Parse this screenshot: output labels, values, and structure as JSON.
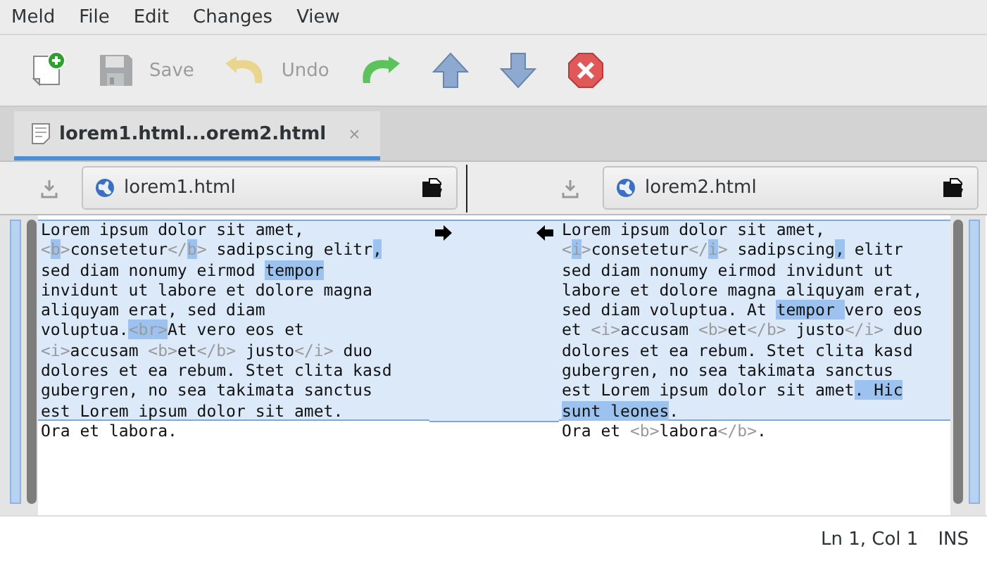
{
  "menu": [
    "Meld",
    "File",
    "Edit",
    "Changes",
    "View"
  ],
  "toolbar": [
    {
      "kind": "new",
      "disabled": false
    },
    {
      "kind": "save",
      "label": "Save",
      "disabled": true
    },
    {
      "kind": "undo",
      "label": "Undo",
      "disabled": true
    },
    {
      "kind": "redo",
      "disabled": false
    },
    {
      "kind": "up",
      "disabled": false
    },
    {
      "kind": "down",
      "disabled": false
    },
    {
      "kind": "stop",
      "disabled": false
    }
  ],
  "tabs": [
    {
      "label": "lorem1.html...orem2.html",
      "close": "×",
      "selected": true
    }
  ],
  "panes": [
    {
      "file": "lorem1.html",
      "lines": [
        {
          "changed": true,
          "segments": [
            {
              "text": "Lorem ipsum dolor sit amet,",
              "markup": false,
              "highlighted": false
            }
          ]
        },
        {
          "changed": true,
          "segments": [
            {
              "text": "<",
              "markup": true,
              "highlighted": false
            },
            {
              "text": "b",
              "markup": true,
              "highlighted": true
            },
            {
              "text": ">",
              "markup": true,
              "highlighted": false
            },
            {
              "text": "consetetur",
              "markup": false,
              "highlighted": false
            },
            {
              "text": "</",
              "markup": true,
              "highlighted": false
            },
            {
              "text": "b",
              "markup": true,
              "highlighted": true
            },
            {
              "text": ">",
              "markup": true,
              "highlighted": false
            },
            {
              "text": " sadipscing elitr",
              "markup": false,
              "highlighted": false
            },
            {
              "text": ",",
              "markup": false,
              "highlighted": true
            }
          ]
        },
        {
          "changed": true,
          "segments": [
            {
              "text": "sed diam nonumy eirmod ",
              "markup": false,
              "highlighted": false
            },
            {
              "text": "tempor",
              "markup": false,
              "highlighted": true
            }
          ]
        },
        {
          "changed": true,
          "segments": [
            {
              "text": "invidunt ut labore et dolore magna",
              "markup": false,
              "highlighted": false
            }
          ]
        },
        {
          "changed": true,
          "segments": [
            {
              "text": "aliquyam erat, sed diam",
              "markup": false,
              "highlighted": false
            }
          ]
        },
        {
          "changed": true,
          "segments": [
            {
              "text": "voluptua.",
              "markup": false,
              "highlighted": false
            },
            {
              "text": "<br>",
              "markup": true,
              "highlighted": true
            },
            {
              "text": "At vero eos et",
              "markup": false,
              "highlighted": false
            }
          ]
        },
        {
          "changed": true,
          "segments": [
            {
              "text": "<i>",
              "markup": true,
              "highlighted": false
            },
            {
              "text": "accusam ",
              "markup": false,
              "highlighted": false
            },
            {
              "text": "<b>",
              "markup": true,
              "highlighted": false
            },
            {
              "text": "et",
              "markup": false,
              "highlighted": false
            },
            {
              "text": "</b>",
              "markup": true,
              "highlighted": false
            },
            {
              "text": " justo",
              "markup": false,
              "highlighted": false
            },
            {
              "text": "</i>",
              "markup": true,
              "highlighted": false
            },
            {
              "text": " duo",
              "markup": false,
              "highlighted": false
            }
          ]
        },
        {
          "changed": true,
          "segments": [
            {
              "text": "dolores et ea rebum. Stet clita kasd",
              "markup": false,
              "highlighted": false
            }
          ]
        },
        {
          "changed": true,
          "segments": [
            {
              "text": "gubergren, no sea takimata sanctus",
              "markup": false,
              "highlighted": false
            }
          ]
        },
        {
          "changed": true,
          "segments": [
            {
              "text": "est Lorem ipsum dolor sit amet.",
              "markup": false,
              "highlighted": false
            }
          ]
        },
        {
          "changed": false,
          "segments": [
            {
              "text": "Ora et labora.",
              "markup": false,
              "highlighted": false
            }
          ]
        }
      ]
    },
    {
      "file": "lorem2.html",
      "lines": [
        {
          "changed": true,
          "segments": [
            {
              "text": "Lorem ipsum dolor sit amet,",
              "markup": false,
              "highlighted": false
            }
          ]
        },
        {
          "changed": true,
          "segments": [
            {
              "text": "<",
              "markup": true,
              "highlighted": false
            },
            {
              "text": "i",
              "markup": true,
              "highlighted": true
            },
            {
              "text": ">",
              "markup": true,
              "highlighted": false
            },
            {
              "text": "consetetur",
              "markup": false,
              "highlighted": false
            },
            {
              "text": "</",
              "markup": true,
              "highlighted": false
            },
            {
              "text": "i",
              "markup": true,
              "highlighted": true
            },
            {
              "text": ">",
              "markup": true,
              "highlighted": false
            },
            {
              "text": " sadipscing",
              "markup": false,
              "highlighted": false
            },
            {
              "text": ",",
              "markup": false,
              "highlighted": true
            },
            {
              "text": " elitr",
              "markup": false,
              "highlighted": false
            }
          ]
        },
        {
          "changed": true,
          "segments": [
            {
              "text": "sed diam nonumy eirmod invidunt ut",
              "markup": false,
              "highlighted": false
            }
          ]
        },
        {
          "changed": true,
          "segments": [
            {
              "text": "labore et dolore magna aliquyam erat,",
              "markup": false,
              "highlighted": false
            }
          ]
        },
        {
          "changed": true,
          "segments": [
            {
              "text": "sed diam voluptua. At ",
              "markup": false,
              "highlighted": false
            },
            {
              "text": "tempor ",
              "markup": false,
              "highlighted": true
            },
            {
              "text": "vero eos",
              "markup": false,
              "highlighted": false
            }
          ]
        },
        {
          "changed": true,
          "segments": [
            {
              "text": "et ",
              "markup": false,
              "highlighted": false
            },
            {
              "text": "<i>",
              "markup": true,
              "highlighted": false
            },
            {
              "text": "accusam ",
              "markup": false,
              "highlighted": false
            },
            {
              "text": "<b>",
              "markup": true,
              "highlighted": false
            },
            {
              "text": "et",
              "markup": false,
              "highlighted": false
            },
            {
              "text": "</b>",
              "markup": true,
              "highlighted": false
            },
            {
              "text": " justo",
              "markup": false,
              "highlighted": false
            },
            {
              "text": "</i>",
              "markup": true,
              "highlighted": false
            },
            {
              "text": " duo",
              "markup": false,
              "highlighted": false
            }
          ]
        },
        {
          "changed": true,
          "segments": [
            {
              "text": "dolores et ea rebum. Stet clita kasd",
              "markup": false,
              "highlighted": false
            }
          ]
        },
        {
          "changed": true,
          "segments": [
            {
              "text": "gubergren, no sea takimata sanctus",
              "markup": false,
              "highlighted": false
            }
          ]
        },
        {
          "changed": true,
          "segments": [
            {
              "text": "est Lorem ipsum dolor sit amet",
              "markup": false,
              "highlighted": false
            },
            {
              "text": ". Hic",
              "markup": false,
              "highlighted": true
            }
          ]
        },
        {
          "changed": true,
          "segments": [
            {
              "text": "sunt leones",
              "markup": false,
              "highlighted": true
            },
            {
              "text": ".",
              "markup": false,
              "highlighted": false
            }
          ]
        },
        {
          "changed": false,
          "segments": [
            {
              "text": "Ora et ",
              "markup": false,
              "highlighted": false
            },
            {
              "text": "<b>",
              "markup": true,
              "highlighted": false
            },
            {
              "text": "labora",
              "markup": false,
              "highlighted": false
            },
            {
              "text": "</b>",
              "markup": true,
              "highlighted": false
            },
            {
              "text": ".",
              "markup": false,
              "highlighted": false
            }
          ]
        }
      ]
    }
  ],
  "status": {
    "position": "Ln 1, Col 1",
    "mode": "INS"
  }
}
